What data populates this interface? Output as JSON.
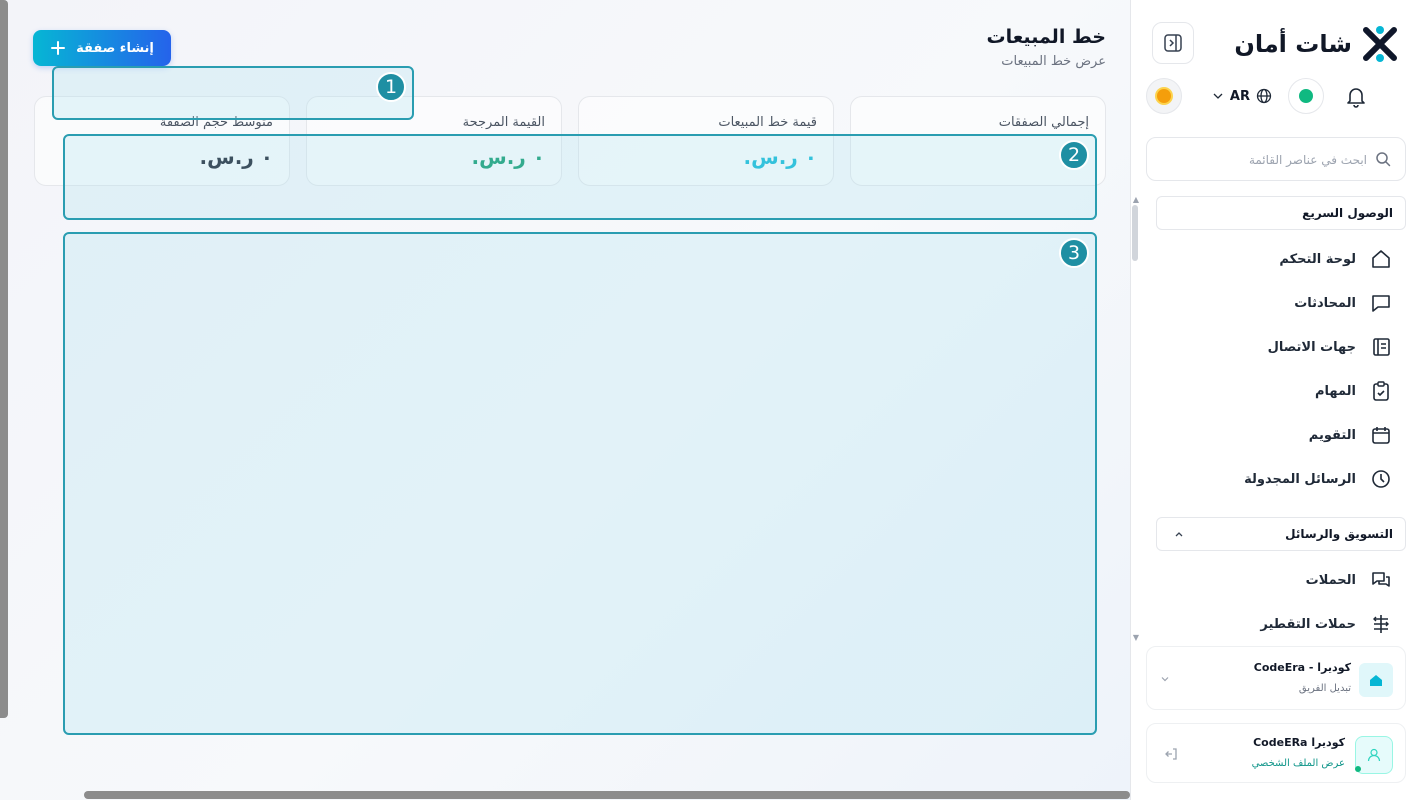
{
  "app": {
    "name": "شات أمان",
    "accent_color": "#1f8fa3",
    "brand_colors": [
      "#06b6d4",
      "#2563eb",
      "#0f172a"
    ]
  },
  "header": {
    "lang_label": "AR",
    "status": "online",
    "theme_icon": "sun-icon"
  },
  "search": {
    "placeholder": "ابحث في عناصر القائمة"
  },
  "sidebar": {
    "quick_access_label": "الوصول السريع",
    "items": [
      {
        "label": "لوحة التحكم",
        "icon": "home-icon"
      },
      {
        "label": "المحادثات",
        "icon": "chat-icon"
      },
      {
        "label": "جهات الاتصال",
        "icon": "contacts-icon"
      },
      {
        "label": "المهام",
        "icon": "tasks-icon"
      },
      {
        "label": "التقويم",
        "icon": "calendar-icon"
      },
      {
        "label": "الرسائل المجدولة",
        "icon": "clock-icon"
      }
    ],
    "marketing_label": "التسويق والرسائل",
    "marketing_items": [
      {
        "label": "الحملات",
        "icon": "campaigns-icon"
      },
      {
        "label": "حملات التقطير",
        "icon": "drip-icon"
      }
    ],
    "team": {
      "name": "كوديرا - CodeEra",
      "switch_label": "تبديل الفريق"
    },
    "profile": {
      "name": "كوديرا CodeERa",
      "link_label": "عرض الملف الشخصي"
    }
  },
  "main": {
    "title": "خط المبيعات",
    "subtitle": "عرض خط المبيعات",
    "create_button_label": "إنشاء صفقة",
    "stats": [
      {
        "label": "إجمالي الصفقات",
        "value": "",
        "color": "#111827"
      },
      {
        "label": "قيمة خط المبيعات",
        "value": "٠ ر.س.",
        "color": "#06b6d4"
      },
      {
        "label": "القيمة المرجحة",
        "value": "٠ ر.س.",
        "color": "#059669"
      },
      {
        "label": "متوسط حجم الصفقة",
        "value": "٠ ر.س.",
        "color": "#111827"
      }
    ]
  },
  "annotations": [
    "1",
    "2",
    "3"
  ]
}
